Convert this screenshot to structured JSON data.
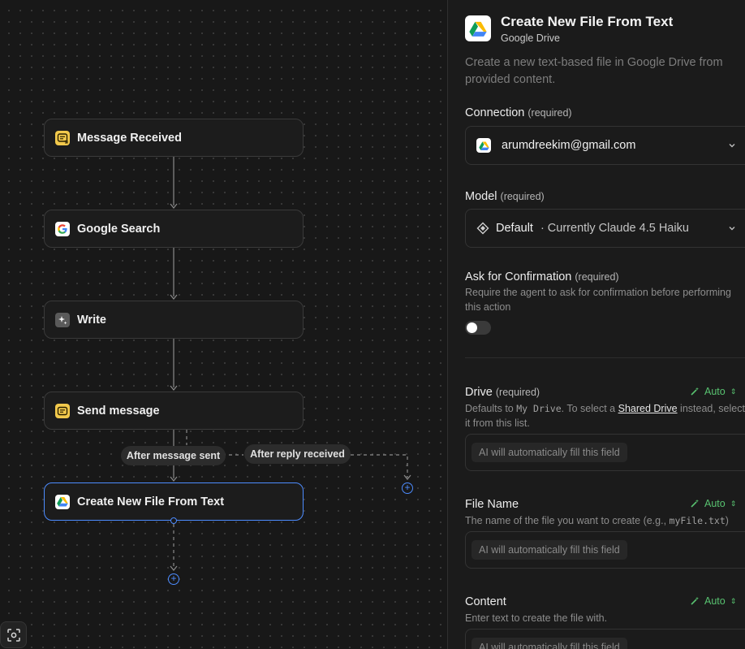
{
  "canvas": {
    "nodes": [
      {
        "label": "Message Received",
        "icon": "message-trigger-icon"
      },
      {
        "label": "Google Search",
        "icon": "google-icon"
      },
      {
        "label": "Write",
        "icon": "sparkle-icon"
      },
      {
        "label": "Send message",
        "icon": "message-icon"
      },
      {
        "label": "Create New File From Text",
        "icon": "google-drive-icon"
      }
    ],
    "branches": {
      "after_sent": "After message sent",
      "after_reply": "After reply received"
    },
    "accent": "#4d8cff"
  },
  "panel": {
    "title": "Create New File From Text",
    "subtitle": "Google Drive",
    "description": "Create a new text-based file in Google Drive from provided content.",
    "connection": {
      "label": "Connection",
      "required": "(required)",
      "value": "arumdreekim@gmail.com"
    },
    "model": {
      "label": "Model",
      "required": "(required)",
      "value": "Default",
      "detail": "· Currently Claude 4.5 Haiku"
    },
    "confirmation": {
      "label": "Ask for Confirmation",
      "required": "(required)",
      "help": "Require the agent to ask for confirmation before performing this action",
      "enabled": false
    },
    "drive": {
      "label": "Drive",
      "required": "(required)",
      "auto": "Auto",
      "help_prefix": "Defaults to",
      "help_code": "My Drive",
      "help_middle": ". To select a",
      "help_link": "Shared Drive",
      "help_suffix": "instead, select it from this list.",
      "placeholder": "AI will automatically fill this field"
    },
    "file_name": {
      "label": "File Name",
      "auto": "Auto",
      "help_prefix": "The name of the file you want to create (e.g.,",
      "help_code": "myFile.txt",
      "help_suffix": ")",
      "placeholder": "AI will automatically fill this field"
    },
    "content": {
      "label": "Content",
      "auto": "Auto",
      "help": "Enter text to create the file with.",
      "placeholder": "AI will automatically fill this field"
    },
    "auto_color": "#58c270"
  }
}
